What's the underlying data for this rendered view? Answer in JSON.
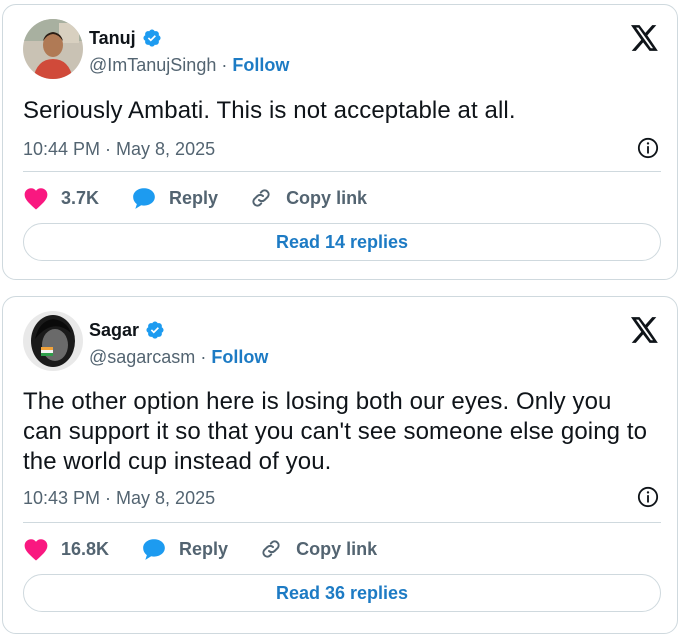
{
  "tweets": [
    {
      "name": "Tanuj",
      "handle": "@ImTanujSingh",
      "separator": "·",
      "follow_label": "Follow",
      "text": "Seriously Ambati. This is not acceptable at all.",
      "timestamp": "10:44 PM · May 8, 2025",
      "likes": "3.7K",
      "reply_label": "Reply",
      "copy_label": "Copy link",
      "read_replies": "Read 14 replies"
    },
    {
      "name": "Sagar",
      "handle": "@sagarcasm",
      "separator": "·",
      "follow_label": "Follow",
      "text": "The other option here is losing both our eyes. Only you can support it so that you can't see someone else going to the world cup instead of you.",
      "timestamp": "10:43 PM · May 8, 2025",
      "likes": "16.8K",
      "reply_label": "Reply",
      "copy_label": "Copy link",
      "read_replies": "Read 36 replies"
    }
  ],
  "colors": {
    "accent": "#1d7bc4",
    "like": "#f91880",
    "muted": "#536471",
    "verified": "#1d9bf0"
  },
  "icons": [
    "verified-badge-icon",
    "x-logo-icon",
    "info-icon",
    "heart-icon",
    "reply-bubble-icon",
    "link-icon"
  ]
}
